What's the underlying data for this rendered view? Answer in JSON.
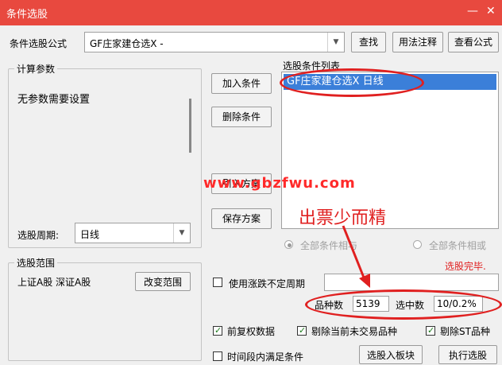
{
  "window": {
    "title": "条件选股",
    "minimize_glyph": "—",
    "close_glyph": "✕"
  },
  "formula": {
    "label": "条件选股公式",
    "value": "GF庄家建仓选X  -",
    "find_btn": "查找",
    "usage_btn": "用法注释",
    "view_btn": "查看公式"
  },
  "params": {
    "legend": "计算参数",
    "text": "无参数需要设置"
  },
  "period": {
    "label": "选股周期:",
    "value": "日线"
  },
  "scope": {
    "legend": "选股范围",
    "value": "上证A股 深证A股",
    "change_btn": "改变范围"
  },
  "conditions": {
    "title": "选股条件列表",
    "items": [
      "GF庄家建仓选X  日线"
    ],
    "add_btn": "加入条件",
    "delete_btn": "删除条件",
    "read_btn": "引入方案",
    "save_btn": "保存方案"
  },
  "logic": {
    "and_label": "全部条件相与",
    "or_label": "全部条件相或"
  },
  "status": "选股完毕.",
  "uncertain": {
    "label": "使用涨跌不定周期"
  },
  "counts": {
    "total_label": "品种数",
    "total_value": "5139",
    "selected_label": "选中数",
    "selected_value": "10/0.2%"
  },
  "options": {
    "fq": "前复权数据",
    "exclude_untraded": "剔除当前未交易品种",
    "exclude_st": "剔除ST品种",
    "time_range": "时间段内满足条件"
  },
  "actions": {
    "to_block": "选股入板块",
    "execute": "执行选股"
  },
  "annotations": {
    "watermark": "www.gbzfwu.com",
    "note": "出票少而精",
    "color": "#e02020"
  }
}
